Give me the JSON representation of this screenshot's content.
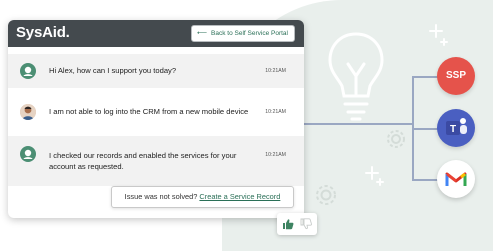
{
  "header": {
    "logo_text": "SysAid",
    "logo_dot": ".",
    "back_button_label": "Back to Self Service Portal",
    "back_icon": "arrow-left-icon"
  },
  "messages": [
    {
      "sender": "bot",
      "text": "Hi Alex, how can I support you today?",
      "time": "10:21AM"
    },
    {
      "sender": "user",
      "text": "I am not able to log into the CRM from a new mobile device",
      "time": "10:21AM"
    },
    {
      "sender": "bot",
      "text_line1": "I checked our records and enabled the services for your",
      "text_line2": "account as requested.",
      "time": "10:21AM"
    }
  ],
  "issue": {
    "prefix": "Issue was not solved?",
    "link": "Create a Service Record"
  },
  "feedback": {
    "up_icon": "thumbs-up-icon",
    "down_icon": "thumbs-down-icon"
  },
  "integrations": [
    {
      "label": "SSP",
      "color": "#e5534b"
    },
    {
      "icon": "teams-icon",
      "color": "#4a5fc1"
    },
    {
      "icon": "gmail-icon",
      "color": "#ffffff"
    }
  ],
  "colors": {
    "accent": "#2a6f57",
    "header": "#444a4e",
    "background_blob": "#e9efec"
  }
}
